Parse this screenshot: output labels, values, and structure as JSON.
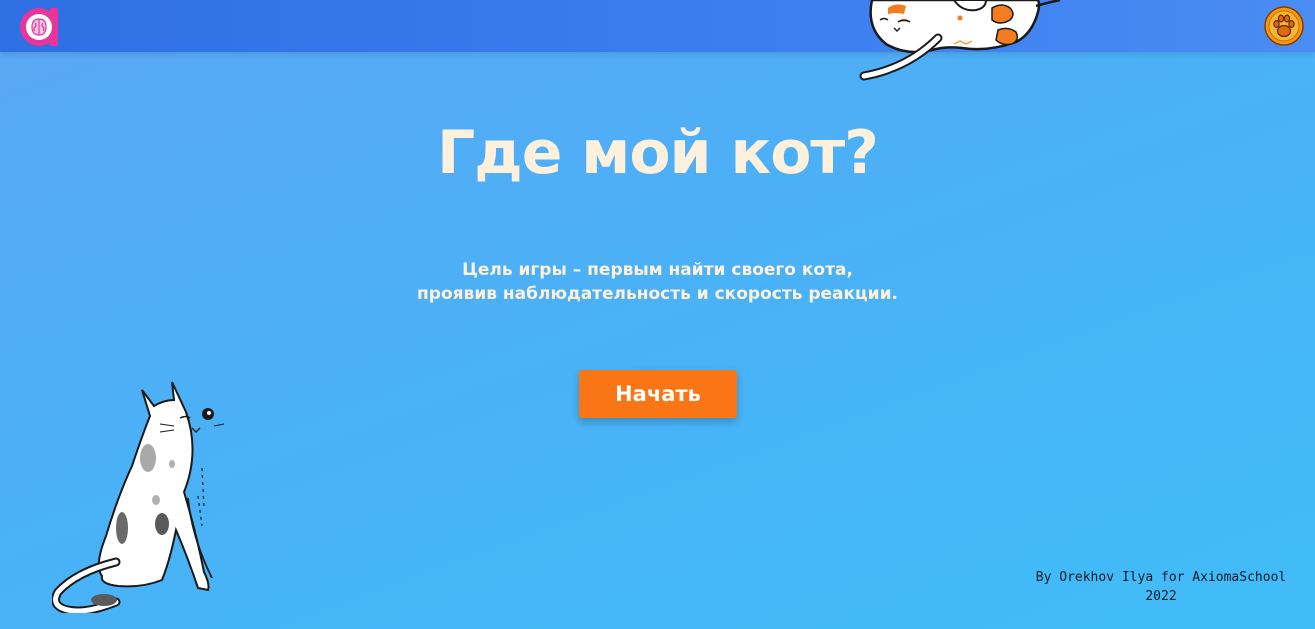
{
  "header": {
    "logo_icon": "brain-logo-icon",
    "paw_button_icon": "paw-icon",
    "colors": {
      "bar": "#3478ec",
      "logo": "#e8349b",
      "paw": "#f29a10"
    }
  },
  "main": {
    "title": "Где мой кот?",
    "description_lines": [
      "Цель игры – первым найти своего кота,",
      "проявив наблюдательность и скорость реакции."
    ],
    "start_button_label": "Начать",
    "colors": {
      "title": "#fdf1de",
      "button": "#fa7516"
    }
  },
  "decorations": {
    "top_cat": "orange-spotted-cat-illustration",
    "bottom_cat": "grey-spotted-sitting-cat-illustration"
  },
  "footer": {
    "credit_line1": "By Orekhov Ilya for AxiomaSchool",
    "credit_line2": "2022"
  }
}
